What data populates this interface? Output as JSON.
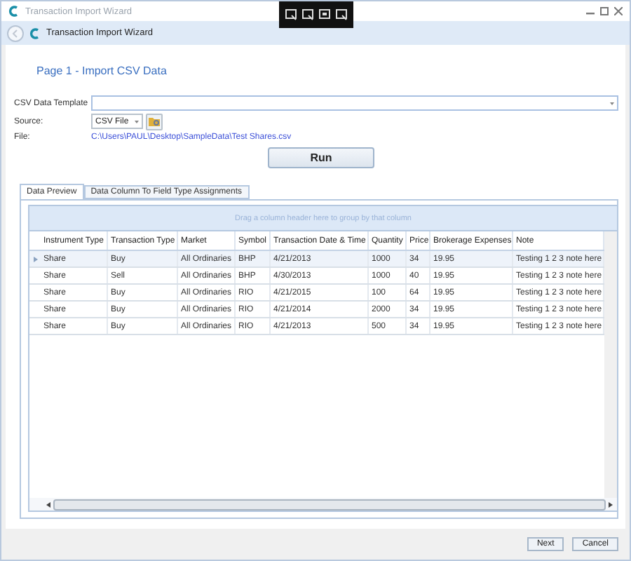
{
  "window": {
    "title": "Transaction Import Wizard"
  },
  "nav": {
    "title": "Transaction Import Wizard"
  },
  "page_title": "Page 1 - Import CSV Data",
  "form": {
    "template_label": "CSV Data Template",
    "source_label": "Source:",
    "source_value": "CSV File",
    "file_label": "File:",
    "file_path": "C:\\Users\\PAUL\\Desktop\\SampleData\\Test Shares.csv",
    "run_button": "Run"
  },
  "tabs": [
    {
      "label": "Data Preview",
      "selected": true
    },
    {
      "label": "Data Column To Field Type Assignments",
      "selected": false
    }
  ],
  "grid": {
    "group_hint": "Drag a column header here to group by that column",
    "columns": [
      "Instrument Type",
      "Transaction Type",
      "Market",
      "Symbol",
      "Transaction Date & Time",
      "Quantity",
      "Price",
      "Brokerage Expenses",
      "Note"
    ],
    "rows": [
      {
        "selected": true,
        "cells": [
          "Share",
          "Buy",
          "All Ordinaries",
          "BHP",
          "4/21/2013",
          "1000",
          "34",
          "19.95",
          "Testing 1 2 3 note here"
        ]
      },
      {
        "selected": false,
        "cells": [
          "Share",
          "Sell",
          "All Ordinaries",
          "BHP",
          "4/30/2013",
          "1000",
          "40",
          "19.95",
          "Testing 1 2 3 note here"
        ]
      },
      {
        "selected": false,
        "cells": [
          "Share",
          "Buy",
          "All Ordinaries",
          "RIO",
          "4/21/2015",
          "100",
          "64",
          "19.95",
          "Testing 1 2 3 note here"
        ]
      },
      {
        "selected": false,
        "cells": [
          "Share",
          "Buy",
          "All Ordinaries",
          "RIO",
          "4/21/2014",
          "2000",
          "34",
          "19.95",
          "Testing 1 2 3 note here"
        ]
      },
      {
        "selected": false,
        "cells": [
          "Share",
          "Buy",
          "All Ordinaries",
          "RIO",
          "4/21/2013",
          "500",
          "34",
          "19.95",
          "Testing 1 2 3 note here"
        ]
      }
    ]
  },
  "buttons": [
    "Next",
    "Cancel"
  ]
}
